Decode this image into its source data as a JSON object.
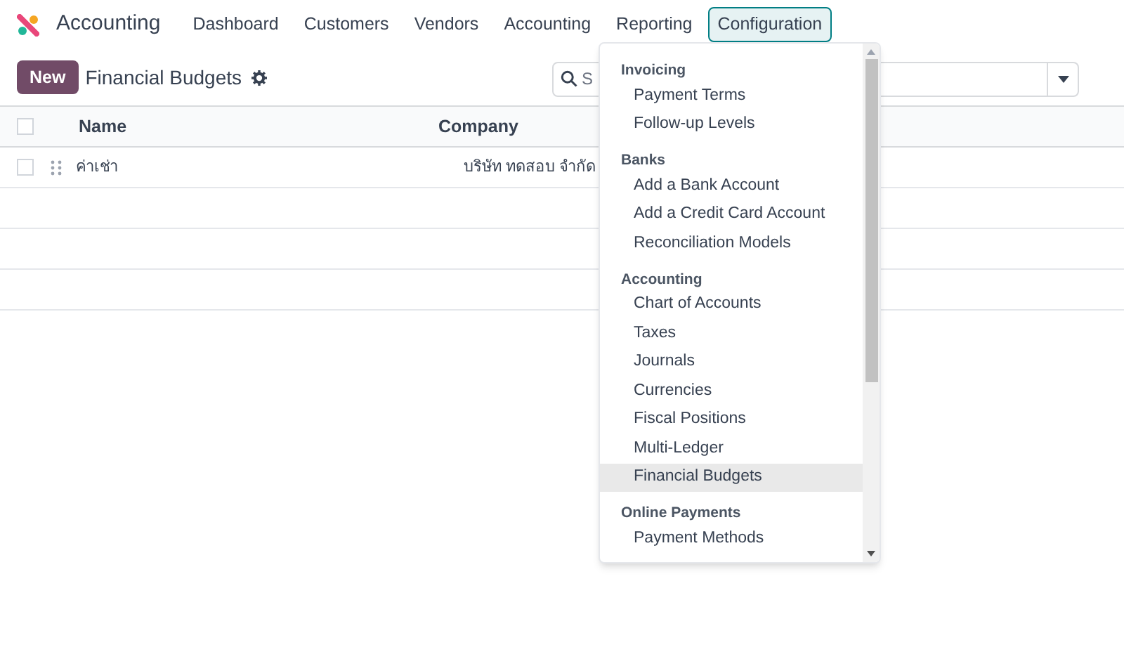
{
  "app": {
    "name": "Accounting"
  },
  "nav": [
    {
      "label": "Dashboard",
      "selected": false
    },
    {
      "label": "Customers",
      "selected": false
    },
    {
      "label": "Vendors",
      "selected": false
    },
    {
      "label": "Accounting",
      "selected": false
    },
    {
      "label": "Reporting",
      "selected": false
    },
    {
      "label": "Configuration",
      "selected": true
    }
  ],
  "control": {
    "new_button": "New",
    "title": "Financial Budgets",
    "search": {
      "placeholder": "S"
    }
  },
  "table": {
    "select_all": {
      "checked": false
    },
    "columns": [
      "Name",
      "Company"
    ],
    "rows": [
      {
        "checked": false,
        "cells": [
          "ค่าเช่า",
          "บริษัท ทดสอบ จำกัด"
        ]
      }
    ]
  },
  "menu": {
    "sections": [
      {
        "title": "Invoicing",
        "items": [
          {
            "label": "Payment Terms",
            "selected": false
          },
          {
            "label": "Follow-up Levels",
            "selected": false
          }
        ]
      },
      {
        "title": "Banks",
        "items": [
          {
            "label": "Add a Bank Account",
            "selected": false
          },
          {
            "label": "Add a Credit Card Account",
            "selected": false
          },
          {
            "label": "Reconciliation Models",
            "selected": false
          }
        ]
      },
      {
        "title": "Accounting",
        "items": [
          {
            "label": "Chart of Accounts",
            "selected": false
          },
          {
            "label": "Taxes",
            "selected": false
          },
          {
            "label": "Journals",
            "selected": false
          },
          {
            "label": "Currencies",
            "selected": false
          },
          {
            "label": "Fiscal Positions",
            "selected": false
          },
          {
            "label": "Multi-Ledger",
            "selected": false
          },
          {
            "label": "Financial Budgets",
            "selected": true
          }
        ]
      },
      {
        "title": "Online Payments",
        "items": [
          {
            "label": "Payment Methods",
            "selected": false
          }
        ]
      }
    ]
  }
}
